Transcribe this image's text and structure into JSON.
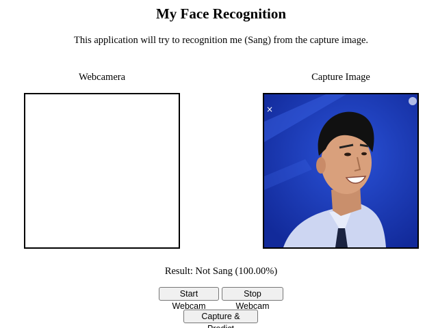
{
  "header": {
    "title": "My Face Recognition",
    "description": "This application will try to recognition me (Sang) from the capture image."
  },
  "panels": {
    "webcam_label": "Webcamera",
    "capture_label": "Capture Image"
  },
  "result": {
    "text": "Result: Not Sang (100.00%)"
  },
  "buttons": {
    "start_webcam": "Start Webcam",
    "stop_webcam": "Stop Webcam",
    "capture_predict": "Capture & Predict"
  },
  "colors": {
    "capture_background": "#1836b8"
  }
}
